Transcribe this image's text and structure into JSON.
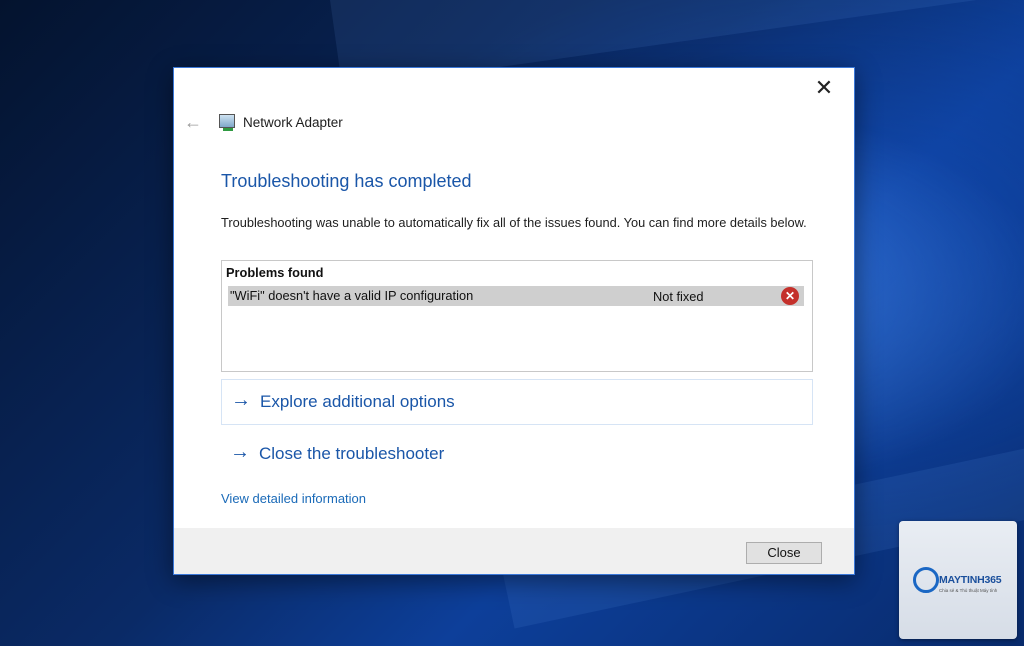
{
  "dialog": {
    "window_title": "Network Adapter",
    "close_glyph": "✕",
    "back_glyph": "←",
    "heading": "Troubleshooting has completed",
    "description": "Troubleshooting was unable to automatically fix all of the issues found. You can find more details below.",
    "problems": {
      "header": "Problems found",
      "rows": [
        {
          "description": "\"WiFi\" doesn't have a valid IP configuration",
          "status": "Not fixed",
          "icon": "error-icon"
        }
      ]
    },
    "options": [
      {
        "label": "Explore additional options",
        "icon": "arrow-right-icon"
      },
      {
        "label": "Close the troubleshooter",
        "icon": "arrow-right-icon"
      }
    ],
    "detail_link": "View detailed information",
    "close_button": "Close"
  },
  "watermark": {
    "brand": "MAYTINH365",
    "tagline": "Chia sẻ & Thủ thuật Máy tính"
  },
  "colors": {
    "accent": "#1a56a8",
    "error": "#c4302b"
  }
}
